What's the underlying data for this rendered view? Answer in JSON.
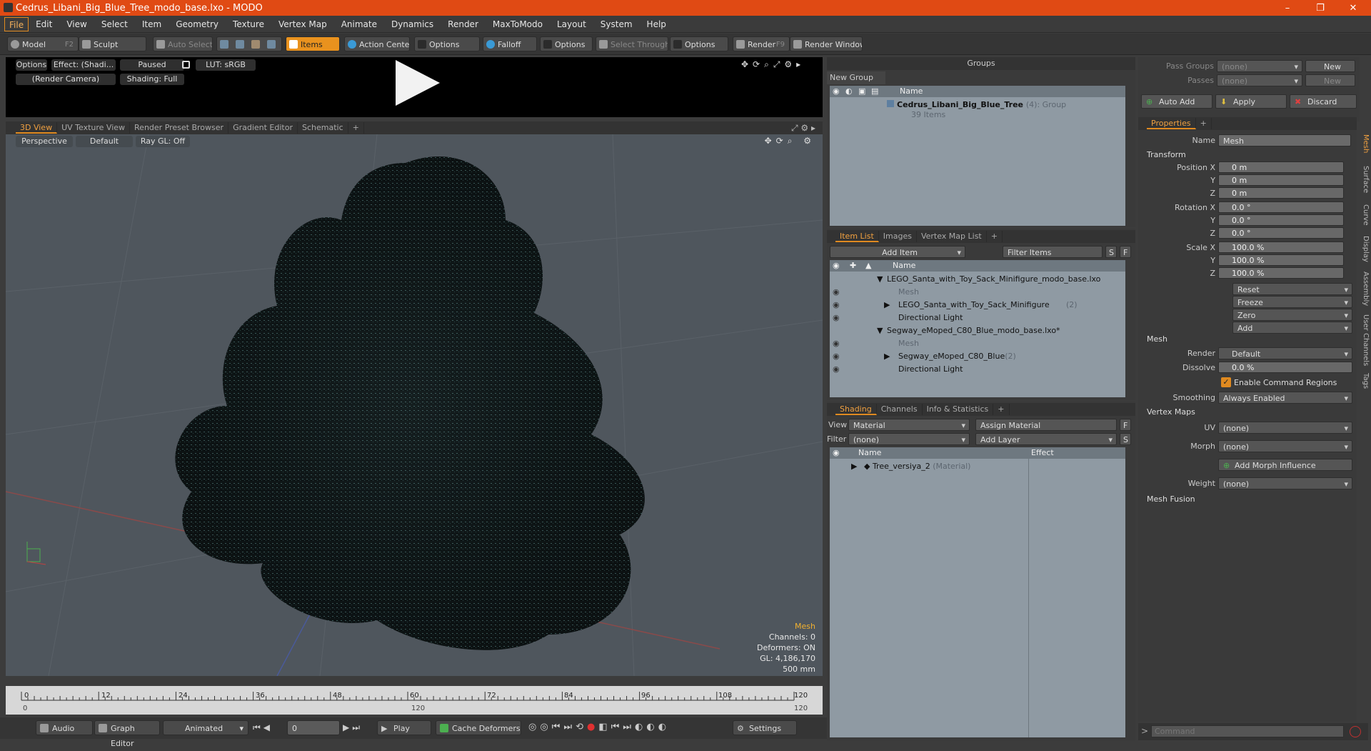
{
  "window": {
    "title": "Cedrus_Libani_Big_Blue_Tree_modo_base.lxo - MODO",
    "minimize": "–",
    "maximize": "❐",
    "close": "✕"
  },
  "menu": [
    "File",
    "Edit",
    "View",
    "Select",
    "Item",
    "Geometry",
    "Texture",
    "Vertex Map",
    "Animate",
    "Dynamics",
    "Render",
    "MaxToModo",
    "Layout",
    "System",
    "Help"
  ],
  "toolbar": {
    "model": "Model",
    "model_key": "F2",
    "sculpt": "Sculpt",
    "auto_select": "Auto Select",
    "items": "Items",
    "action_center": "Action Center",
    "options1": "Options",
    "falloff": "Falloff",
    "options2": "Options",
    "select_through": "Select Through",
    "options3": "Options",
    "render": "Render",
    "render_key": "F9",
    "render_window": "Render Window"
  },
  "preview": {
    "options": "Options",
    "effect": "Effect: (Shadi...",
    "paused": "Paused",
    "lut": "LUT: sRGB",
    "camera": "(Render Camera)",
    "shading": "Shading: Full"
  },
  "view_tabs": [
    "3D View",
    "UV Texture View",
    "Render Preset Browser",
    "Gradient Editor",
    "Schematic"
  ],
  "viewport": {
    "perspective": "Perspective",
    "default": "Default",
    "raygl": "Ray GL: Off",
    "info": {
      "mesh": "Mesh",
      "channels": "Channels: 0",
      "deformers": "Deformers: ON",
      "gl": "GL: 4,186,170",
      "scale": "500 mm"
    }
  },
  "timeline": {
    "ticks": [
      "0",
      "12",
      "24",
      "36",
      "48",
      "60",
      "72",
      "84",
      "96",
      "108",
      "120"
    ],
    "start": "0",
    "mid": "120",
    "end": "120"
  },
  "bottom": {
    "audio": "Audio",
    "graph_editor": "Graph Editor",
    "animated": "Animated",
    "frame": "0",
    "play": "Play",
    "cache_deformers": "Cache Deformers",
    "settings": "Settings"
  },
  "groups": {
    "title": "Groups",
    "new_group": "New Group",
    "col_name": "Name",
    "group_name": "Cedrus_Libani_Big_Blue_Tree",
    "group_count": "(4)",
    "group_type": ": Group",
    "group_items": "39 Items"
  },
  "itemlist": {
    "tabs": [
      "Item List",
      "Images",
      "Vertex Map List"
    ],
    "add_item": "Add Item",
    "filter_items": "Filter Items",
    "s": "S",
    "f": "F",
    "col_name": "Name",
    "rows": [
      {
        "label": "LEGO_Santa_with_Toy_Sack_Minifigure_modo_base.lxo",
        "suffix": "",
        "level": 0,
        "dim": false
      },
      {
        "label": "Mesh",
        "suffix": "",
        "level": 1,
        "dim": true
      },
      {
        "label": "LEGO_Santa_with_Toy_Sack_Minifigure",
        "suffix": "(2)",
        "level": 1,
        "dim": false
      },
      {
        "label": "Directional Light",
        "suffix": "",
        "level": 1,
        "dim": false
      },
      {
        "label": "Segway_eMoped_C80_Blue_modo_base.lxo*",
        "suffix": "",
        "level": 0,
        "dim": false
      },
      {
        "label": "Mesh",
        "suffix": "",
        "level": 1,
        "dim": true
      },
      {
        "label": "Segway_eMoped_C80_Blue",
        "suffix": "(2)",
        "level": 1,
        "dim": false
      },
      {
        "label": "Directional Light",
        "suffix": "",
        "level": 1,
        "dim": false
      }
    ]
  },
  "shading": {
    "tabs": [
      "Shading",
      "Channels",
      "Info & Statistics"
    ],
    "view_label": "View",
    "view_value": "Material",
    "assign_material": "Assign Material",
    "f": "F",
    "filter_label": "Filter",
    "filter_value": "(none)",
    "add_layer": "Add Layer",
    "s": "S",
    "col_name": "Name",
    "col_effect": "Effect",
    "material": "Tree_versiya_2",
    "material_type": "(Material)"
  },
  "passes": {
    "pass_groups": "Pass Groups",
    "passes": "Passes",
    "none1": "(none)",
    "none2": "(none)",
    "new1": "New",
    "new2": "New",
    "auto_add": "Auto Add",
    "apply": "Apply",
    "discard": "Discard"
  },
  "properties": {
    "tab": "Properties",
    "name_label": "Name",
    "name_value": "Mesh",
    "transform": "Transform",
    "position_x": "Position X",
    "y": "Y",
    "z": "Z",
    "pos": [
      "0 m",
      "0 m",
      "0 m"
    ],
    "rotation_x": "Rotation X",
    "rot": [
      "0.0 °",
      "0.0 °",
      "0.0 °"
    ],
    "scale_x": "Scale X",
    "scl": [
      "100.0 %",
      "100.0 %",
      "100.0 %"
    ],
    "reset": "Reset",
    "freeze": "Freeze",
    "zero": "Zero",
    "add": "Add",
    "mesh": "Mesh",
    "render_label": "Render",
    "render_value": "Default",
    "dissolve_label": "Dissolve",
    "dissolve_value": "0.0 %",
    "enable_cmd": "Enable Command Regions",
    "smoothing_label": "Smoothing",
    "smoothing_value": "Always Enabled",
    "vertex_maps": "Vertex Maps",
    "uv_label": "UV",
    "uv_value": "(none)",
    "morph_label": "Morph",
    "morph_value": "(none)",
    "add_morph": "Add Morph Influence",
    "weight_label": "Weight",
    "weight_value": "(none)",
    "mesh_fusion": "Mesh Fusion"
  },
  "side_tabs": [
    "Mesh",
    "Surface",
    "Curve",
    "Display",
    "Assembly",
    "User Channels",
    "Tags"
  ],
  "command": {
    "placeholder": "Command"
  },
  "colors": {
    "accent": "#e08a20",
    "titlebar": "#e04a14"
  }
}
